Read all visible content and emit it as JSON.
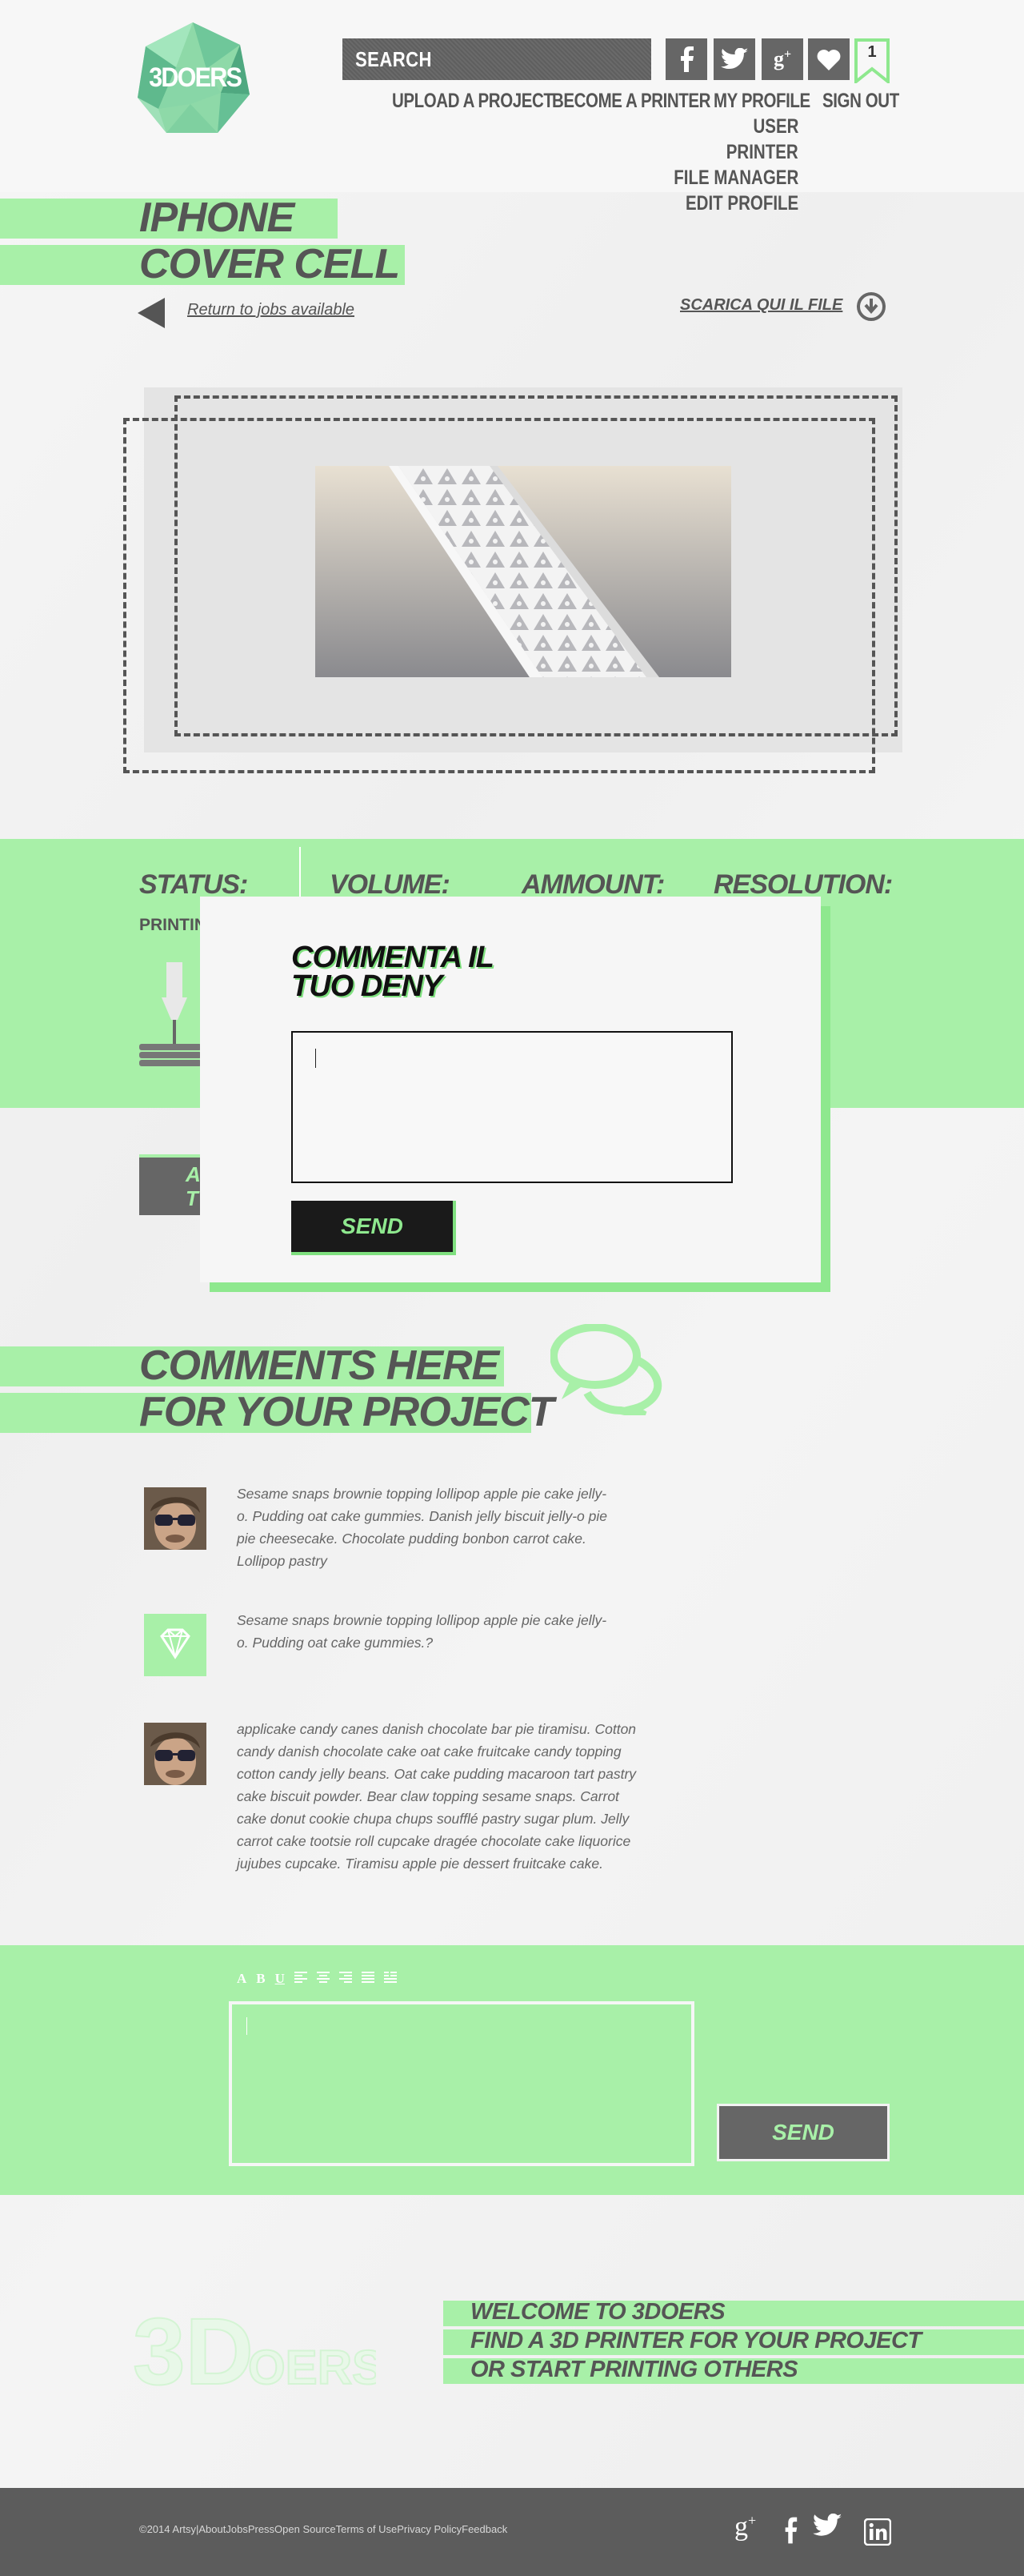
{
  "header": {
    "logo_text": "3DOERS",
    "search_label": "SEARCH",
    "bookmark_count": "1",
    "nav": [
      "UPLOAD A PROJECT",
      "BECOME A PRINTER",
      "MY PROFILE",
      "SIGN OUT"
    ],
    "profile_menu": [
      "USER",
      "PRINTER",
      "FILE MANAGER",
      "EDIT PROFILE"
    ],
    "social_icons": [
      "facebook-icon",
      "twitter-icon",
      "google-plus-icon",
      "heart-icon"
    ]
  },
  "project": {
    "title_line1": "IPHONE",
    "title_line2": "COVER CELL",
    "back_link": "Return  to jobs available",
    "download_link": "SCARICA QUI IL FILE"
  },
  "status": {
    "status_label": "STATUS:",
    "status_value": "PRINTIN",
    "volume_label": "VOLUME:",
    "ammount_label": "AMMOUNT:",
    "resolution_label": "RESOLUTION:",
    "action_button_line1": "A",
    "action_button_line2": "T"
  },
  "modal": {
    "title_line1": "COMMENTA IL",
    "title_line2": "TUO DENY",
    "send_label": "SEND"
  },
  "comments": {
    "heading_line1": "COMMENTS HERE",
    "heading_line2": "FOR YOUR PROJECT",
    "items": [
      {
        "text": "Sesame snaps brownie topping lollipop apple pie cake jelly-o. Pudding oat cake gummies. Danish jelly biscuit jelly-o pie pie cheesecake. Chocolate pudding bonbon carrot cake. Lollipop pastry"
      },
      {
        "text": "Sesame snaps brownie topping lollipop apple pie cake jelly-o. Pudding oat cake gummies.?"
      },
      {
        "text": " applicake candy canes danish chocolate bar pie tiramisu. Cotton candy danish chocolate cake oat cake fruitcake candy topping cotton candy jelly beans. Oat cake pudding macaroon tart pastry cake biscuit powder. Bear claw topping sesame snaps. Carrot cake donut cookie chupa chups soufflé pastry sugar plum. Jelly carrot cake tootsie roll cupcake dragée chocolate cake liquorice jujubes cupcake. Tiramisu apple pie dessert fruitcake cake."
      }
    ]
  },
  "editor": {
    "toolbar": [
      "A",
      "B",
      "U"
    ],
    "send_label": "SEND"
  },
  "welcome": {
    "line1": "WELCOME TO 3DOERS",
    "line2": "FIND A 3D PRINTER FOR YOUR  PROJECT",
    "line3": "OR START PRINTING  OTHERS"
  },
  "footer": {
    "links": "©2014 Artsy|AboutJobsPressOpen SourceTerms of UsePrivacy PolicyFeedback",
    "icons": [
      "google-plus-icon",
      "facebook-icon",
      "twitter-icon",
      "linkedin-icon"
    ]
  },
  "colors": {
    "accent_green": "#a8f0a8",
    "dark_gray": "#5c5c5c",
    "text_gray": "#555555"
  }
}
